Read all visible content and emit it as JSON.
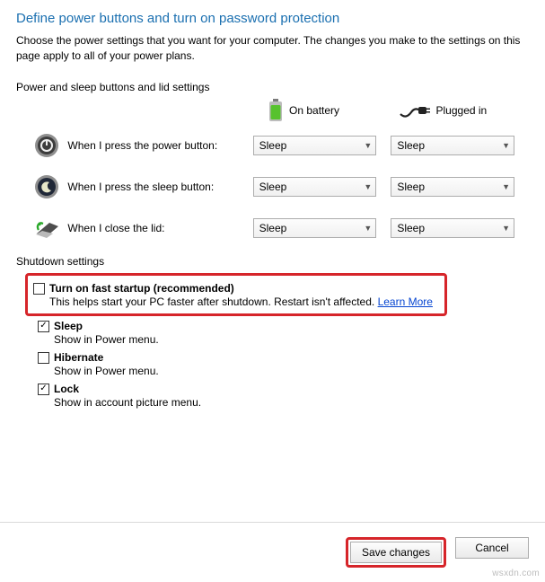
{
  "title": "Define power buttons and turn on password protection",
  "description": "Choose the power settings that you want for your computer. The changes you make to the settings on this page apply to all of your power plans.",
  "section_label": "Power and sleep buttons and lid settings",
  "columns": {
    "battery": "On battery",
    "plugged": "Plugged in"
  },
  "rows": {
    "power": {
      "label": "When I press the power button:",
      "battery": "Sleep",
      "plugged": "Sleep"
    },
    "sleep": {
      "label": "When I press the sleep button:",
      "battery": "Sleep",
      "plugged": "Sleep"
    },
    "lid": {
      "label": "When I close the lid:",
      "battery": "Sleep",
      "plugged": "Sleep"
    }
  },
  "shutdown": {
    "label": "Shutdown settings",
    "fast_startup": {
      "title": "Turn on fast startup (recommended)",
      "desc": "This helps start your PC faster after shutdown. Restart isn't affected. ",
      "link": "Learn More"
    },
    "sleep": {
      "title": "Sleep",
      "desc": "Show in Power menu."
    },
    "hibernate": {
      "title": "Hibernate",
      "desc": "Show in Power menu."
    },
    "lock": {
      "title": "Lock",
      "desc": "Show in account picture menu."
    }
  },
  "buttons": {
    "save": "Save changes",
    "cancel": "Cancel"
  },
  "watermark": "wsxdn.com"
}
